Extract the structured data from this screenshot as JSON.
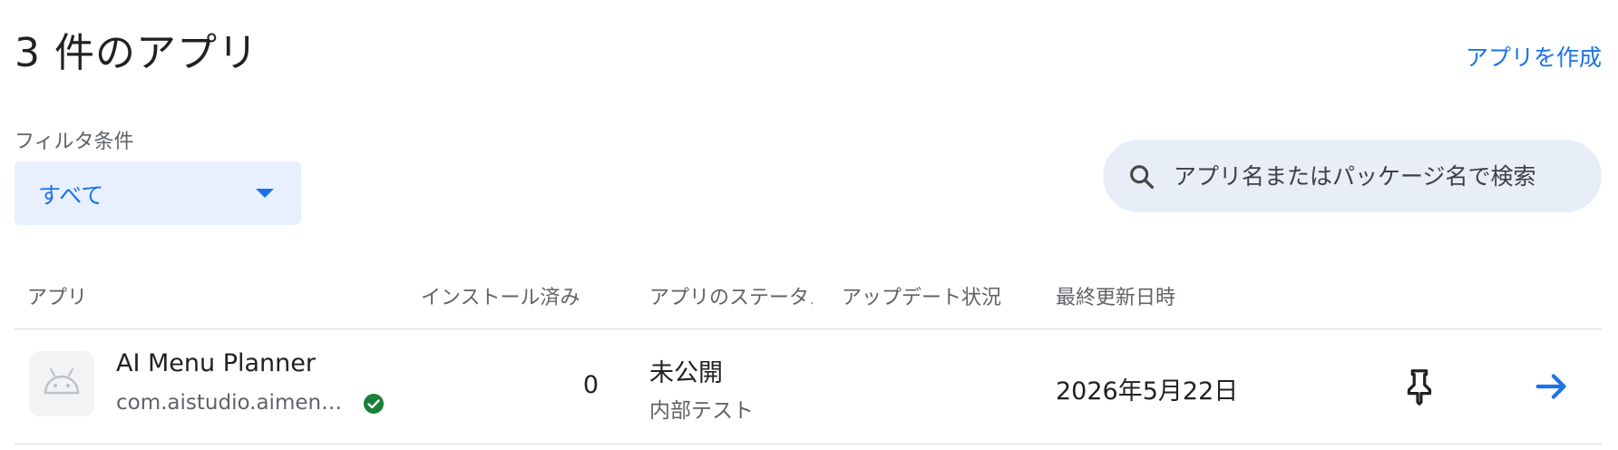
{
  "header": {
    "title": "3 件のアプリ",
    "create_link": "アプリを作成"
  },
  "filter": {
    "label": "フィルタ条件",
    "selected": "すべて"
  },
  "search": {
    "placeholder": "アプリ名またはパッケージ名で検索"
  },
  "table": {
    "columns": [
      "アプリ",
      "インストール済み",
      "アプリのステータス",
      "アップデート状況",
      "最終更新日時"
    ],
    "rows": [
      {
        "name": "AI Menu Planner",
        "package": "com.aistudio.aimenu...",
        "installs": "0",
        "status": "未公開",
        "status_detail": "内部テスト",
        "update_status": "",
        "last_updated": "2026年5月22日"
      }
    ]
  },
  "icons": {
    "app": "android-icon",
    "verified": "check-circle-icon",
    "pin": "pin-icon",
    "open": "arrow-right-icon",
    "search": "search-icon",
    "filter_caret": "caret-down-icon"
  },
  "colors": {
    "accent": "#1a73e8",
    "filter_bg": "#e8f0fe",
    "search_bg": "#e8eef8",
    "verified": "#188038",
    "divider": "#dadce0"
  }
}
